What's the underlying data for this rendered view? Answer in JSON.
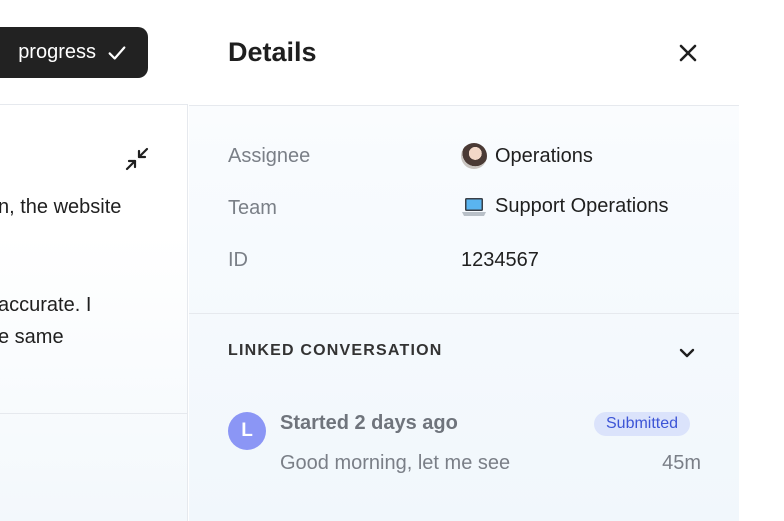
{
  "left_panel": {
    "status_label": "progress",
    "text_lines": [
      "n, the website",
      "accurate. I",
      "e same"
    ]
  },
  "details": {
    "title": "Details",
    "fields": [
      {
        "label": "Assignee",
        "value": "Operations",
        "icon": "avatar"
      },
      {
        "label": "Team",
        "value": "Support Operations",
        "icon": "laptop-icon"
      },
      {
        "label": "ID",
        "value": "1234567",
        "icon": ""
      }
    ],
    "linked_conversation": {
      "section_title": "LINKED CONVERSATION",
      "item": {
        "avatar_letter": "L",
        "title": "Started 2 days ago",
        "badge": "Submitted",
        "snippet": "Good morning, let me see",
        "time": "45m"
      }
    }
  },
  "colors": {
    "status_button_bg": "#222222",
    "avatar_bg": "#8b96f5",
    "badge_bg": "#dbe3fb",
    "badge_text": "#3d55d6"
  }
}
